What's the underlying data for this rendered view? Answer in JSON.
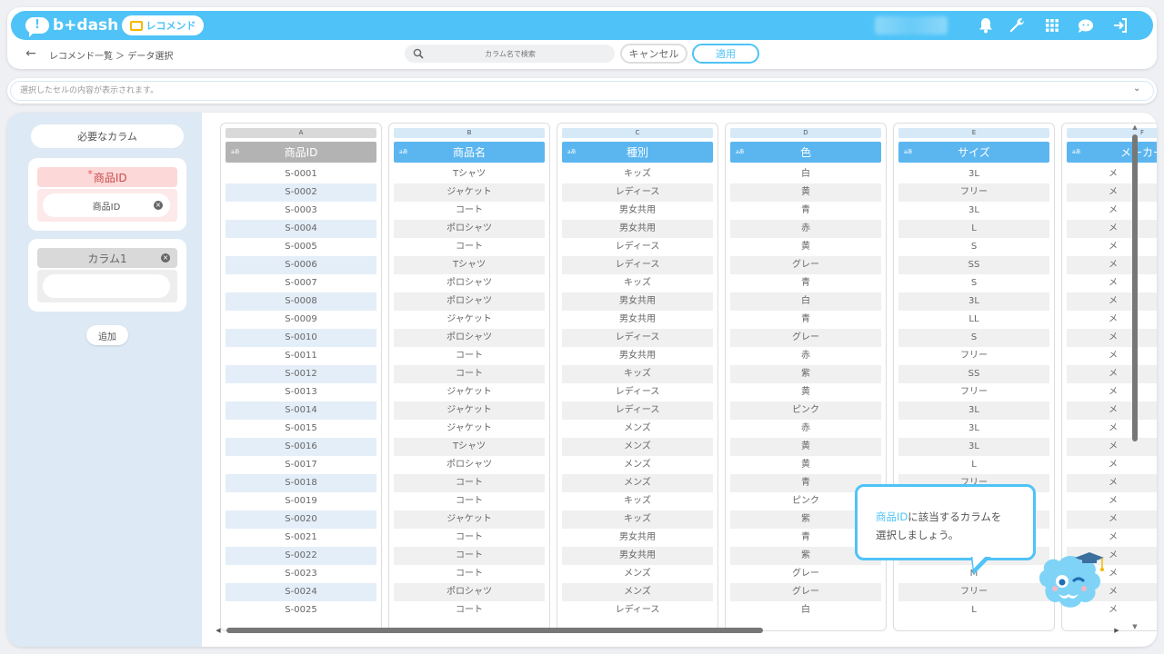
{
  "header": {
    "logo_text": "b+dash",
    "logo_mark": "!",
    "section_badge": "レコメンド",
    "icons": [
      "bell-icon",
      "wrench-icon",
      "grid-icon",
      "chat-face-icon",
      "logout-icon"
    ],
    "accent_color": "#4fc3f7"
  },
  "toolbar": {
    "breadcrumb": "レコメンド一覧 ＞ データ選択",
    "search_placeholder": "カラム名で検索",
    "cancel_label": "キャンセル",
    "apply_label": "適用"
  },
  "cellbar": {
    "text": "選択したセルの内容が表示されます。"
  },
  "left": {
    "required_title": "必要なカラム",
    "required_field_label": "商品ID",
    "required_star": "*",
    "required_field_value": "商品ID",
    "optional_field_label": "カラム1",
    "add_label": "追加"
  },
  "table": {
    "type_badge": "aあ",
    "columns": [
      {
        "letter": "A",
        "name": "商品ID",
        "values": [
          "S-0001",
          "S-0002",
          "S-0003",
          "S-0004",
          "S-0005",
          "S-0006",
          "S-0007",
          "S-0008",
          "S-0009",
          "S-0010",
          "S-0011",
          "S-0012",
          "S-0013",
          "S-0014",
          "S-0015",
          "S-0016",
          "S-0017",
          "S-0018",
          "S-0019",
          "S-0020",
          "S-0021",
          "S-0022",
          "S-0023",
          "S-0024",
          "S-0025"
        ]
      },
      {
        "letter": "B",
        "name": "商品名",
        "values": [
          "Tシャツ",
          "ジャケット",
          "コート",
          "ポロシャツ",
          "コート",
          "Tシャツ",
          "ポロシャツ",
          "ポロシャツ",
          "ジャケット",
          "ポロシャツ",
          "コート",
          "コート",
          "ジャケット",
          "ジャケット",
          "ジャケット",
          "Tシャツ",
          "ポロシャツ",
          "コート",
          "コート",
          "ジャケット",
          "コート",
          "コート",
          "コート",
          "ポロシャツ",
          "コート"
        ]
      },
      {
        "letter": "C",
        "name": "種別",
        "values": [
          "キッズ",
          "レディース",
          "男女共用",
          "男女共用",
          "レディース",
          "レディース",
          "キッズ",
          "男女共用",
          "男女共用",
          "レディース",
          "男女共用",
          "キッズ",
          "レディース",
          "レディース",
          "メンズ",
          "メンズ",
          "メンズ",
          "メンズ",
          "キッズ",
          "キッズ",
          "男女共用",
          "男女共用",
          "メンズ",
          "メンズ",
          "レディース"
        ]
      },
      {
        "letter": "D",
        "name": "色",
        "values": [
          "白",
          "黄",
          "青",
          "赤",
          "黄",
          "グレー",
          "青",
          "白",
          "青",
          "グレー",
          "赤",
          "紫",
          "黄",
          "ピンク",
          "赤",
          "黄",
          "黄",
          "青",
          "ピンク",
          "紫",
          "青",
          "紫",
          "グレー",
          "グレー",
          "白"
        ]
      },
      {
        "letter": "E",
        "name": "サイズ",
        "values": [
          "3L",
          "フリー",
          "3L",
          "L",
          "S",
          "SS",
          "S",
          "3L",
          "LL",
          "S",
          "フリー",
          "SS",
          "フリー",
          "3L",
          "3L",
          "3L",
          "L",
          "フリー",
          "",
          "",
          "",
          "",
          "M",
          "フリー",
          "L"
        ]
      },
      {
        "letter": "F",
        "name": "メーカー",
        "values": [
          "メ",
          "メ",
          "メ",
          "メ",
          "メ",
          "メ",
          "メ",
          "メ",
          "メ",
          "メ",
          "メ",
          "メ",
          "メ",
          "メ",
          "メ",
          "メ",
          "メ",
          "メ",
          "メ",
          "メ",
          "メ",
          "メ",
          "メ",
          "メ",
          "メ"
        ]
      }
    ]
  },
  "tip": {
    "highlight": "商品ID",
    "text_line1": "に該当するカラムを",
    "text_line2": "選択しましょう。"
  }
}
